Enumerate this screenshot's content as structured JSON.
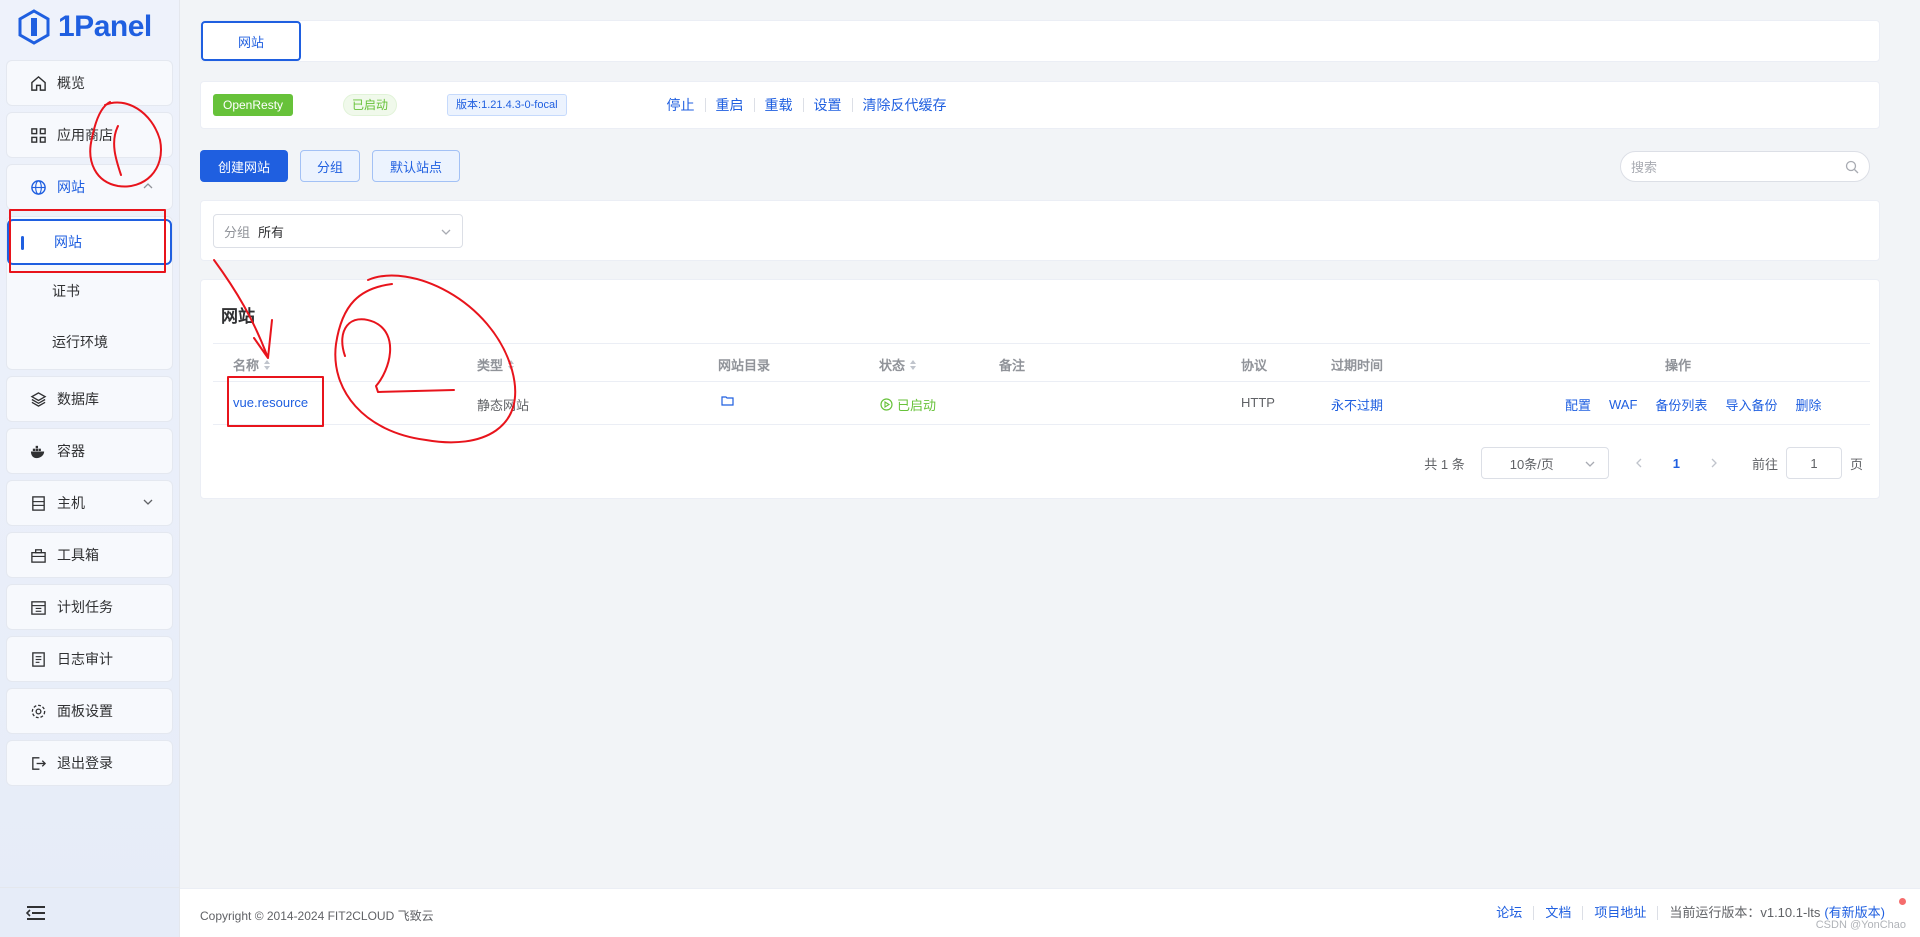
{
  "app": {
    "logo_text": "1Panel"
  },
  "sidebar": {
    "items": [
      {
        "label": "概览",
        "icon": "home-icon"
      },
      {
        "label": "应用商店",
        "icon": "grid-icon"
      },
      {
        "label": "网站",
        "icon": "globe-icon"
      },
      {
        "label": "数据库",
        "icon": "layers-icon"
      },
      {
        "label": "容器",
        "icon": "docker-icon"
      },
      {
        "label": "主机",
        "icon": "server-icon"
      },
      {
        "label": "工具箱",
        "icon": "toolbox-icon"
      },
      {
        "label": "计划任务",
        "icon": "calendar-icon"
      },
      {
        "label": "日志审计",
        "icon": "log-icon"
      },
      {
        "label": "面板设置",
        "icon": "gear-icon"
      },
      {
        "label": "退出登录",
        "icon": "logout-icon"
      }
    ],
    "submenu": [
      {
        "label": "网站"
      },
      {
        "label": "证书"
      },
      {
        "label": "运行环境"
      }
    ]
  },
  "tabs": [
    {
      "label": "网站"
    }
  ],
  "status": {
    "app_name": "OpenResty",
    "state": "已启动",
    "version": "版本:1.21.4.3-0-focal",
    "actions": [
      "停止",
      "重启",
      "重载",
      "设置",
      "清除反代缓存"
    ]
  },
  "toolbar": {
    "create_label": "创建网站",
    "group_label": "分组",
    "default_site_label": "默认站点",
    "search_placeholder": "搜索"
  },
  "filter": {
    "prefix": "分组",
    "value": "所有"
  },
  "table": {
    "title": "网站",
    "columns": [
      "名称",
      "类型",
      "网站目录",
      "状态",
      "备注",
      "协议",
      "过期时间",
      "操作"
    ],
    "rows": [
      {
        "name": "vue.resource",
        "type": "静态网站",
        "status": "已启动",
        "remark": "",
        "protocol": "HTTP",
        "expire": "永不过期",
        "actions": [
          "配置",
          "WAF",
          "备份列表",
          "导入备份",
          "删除"
        ]
      }
    ]
  },
  "pagination": {
    "total_text": "共 1 条",
    "page_size": "10条/页",
    "current_page": "1",
    "goto_label": "前往",
    "goto_value": "1",
    "page_unit": "页"
  },
  "footer": {
    "copyright": "Copyright © 2014-2024 FIT2CLOUD 飞致云",
    "links": [
      "论坛",
      "文档",
      "项目地址"
    ],
    "version_text": "当前运行版本：v1.10.1-lts",
    "update_link": "(有新版本)",
    "watermark": "CSDN @YonChao"
  },
  "colors": {
    "primary": "#1f5fe0",
    "success": "#67c23a",
    "annotation": "#e8141c"
  }
}
